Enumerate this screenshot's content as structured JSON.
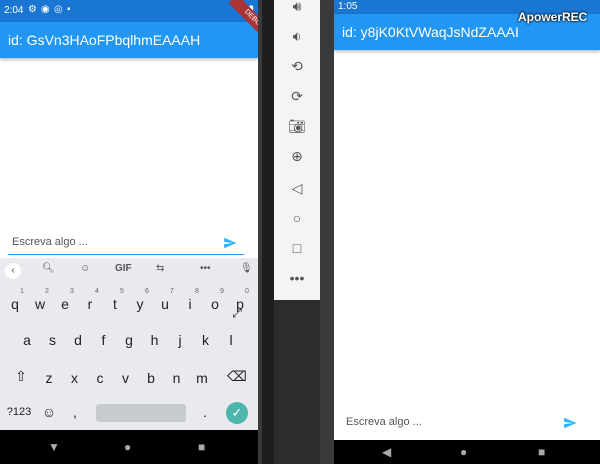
{
  "left": {
    "status_time": "2:04",
    "app_title": "id: GsVn3HAoFPbqlhmEAAAH",
    "debug_label": "DEBUG",
    "input_placeholder": "Escreva algo ...",
    "keyboard": {
      "toolbar_gif": "GIF",
      "row1": [
        "q",
        "w",
        "e",
        "r",
        "t",
        "y",
        "u",
        "i",
        "o",
        "p"
      ],
      "row1_nums": [
        "1",
        "2",
        "3",
        "4",
        "5",
        "6",
        "7",
        "8",
        "9",
        "0"
      ],
      "row2": [
        "a",
        "s",
        "d",
        "f",
        "g",
        "h",
        "j",
        "k",
        "l"
      ],
      "row3": [
        "z",
        "x",
        "c",
        "v",
        "b",
        "n",
        "m"
      ],
      "symbols_key": "?123",
      "comma_key": ",",
      "period_key": "."
    }
  },
  "right": {
    "status_time": "1:05",
    "app_title": "id: y8jK0KtVWaqJsNdZAAAI",
    "input_placeholder": "Escreva algo ...",
    "recorder_label": "ApowerREC"
  },
  "colors": {
    "appbar": "#2196f3",
    "statusbar": "#1976d2",
    "send_icon": "#29b6f6",
    "enter_key": "#4db6ac"
  }
}
